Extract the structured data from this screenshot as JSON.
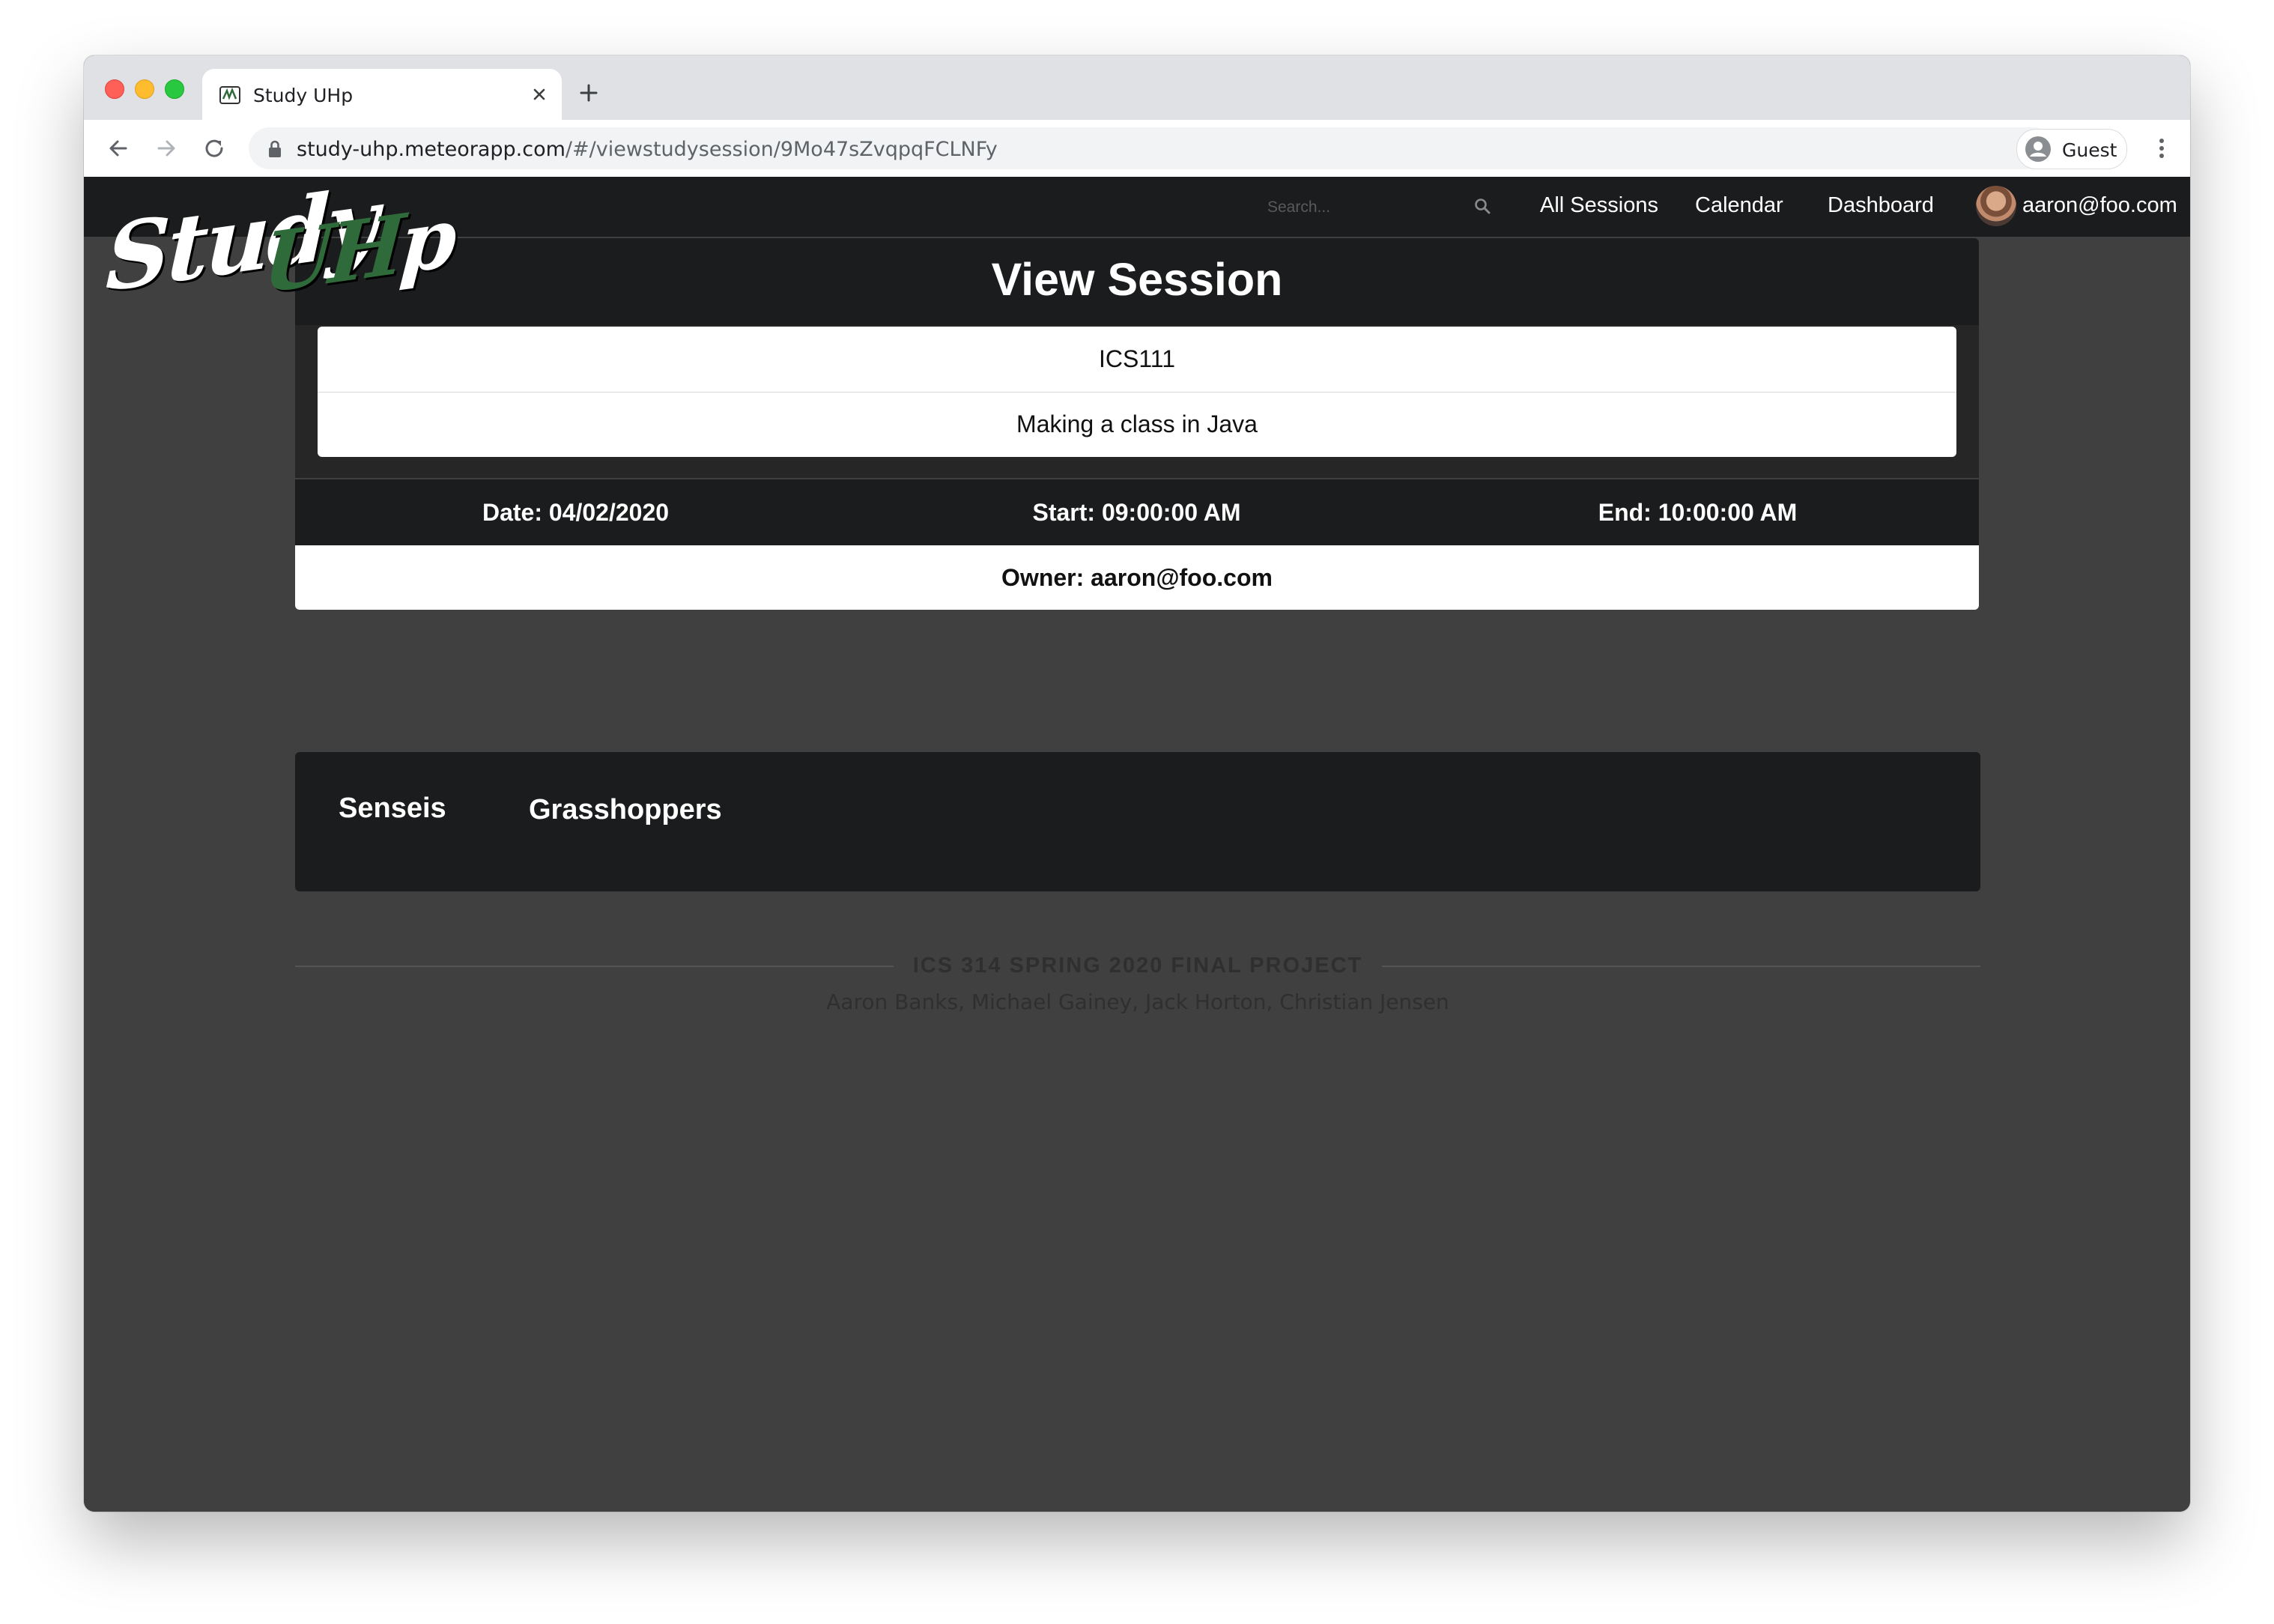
{
  "browser": {
    "tab_title": "Study UHp",
    "url_host": "study-uhp.meteorapp.com",
    "url_path": "/#/viewstudysession/9Mo47sZvqpqFCLNFy",
    "profile_label": "Guest"
  },
  "navbar": {
    "logo_study": "Study",
    "logo_uh": "UH",
    "logo_p": "p",
    "search_placeholder": "Search...",
    "links": [
      "All Sessions",
      "Calendar",
      "Dashboard"
    ],
    "user": "aaron@foo.com"
  },
  "session": {
    "heading": "View Session",
    "course": "ICS111",
    "topic": "Making a class in Java",
    "date": "Date: 04/02/2020",
    "start": "Start: 09:00:00 AM",
    "end": "End: 10:00:00 AM",
    "owner": "Owner: aaron@foo.com"
  },
  "groups": {
    "senseis": "Senseis",
    "grasshoppers": "Grasshoppers"
  },
  "footer": {
    "title": "ICS 314 SPRING 2020 FINAL PROJECT",
    "names": "Aaron Banks, Michael Gainey, Jack Horton, Christian Jensen"
  },
  "colors": {
    "navbar_bg": "#1b1c1d",
    "page_bg": "#404040",
    "logo_accent": "#2f6b3a"
  }
}
